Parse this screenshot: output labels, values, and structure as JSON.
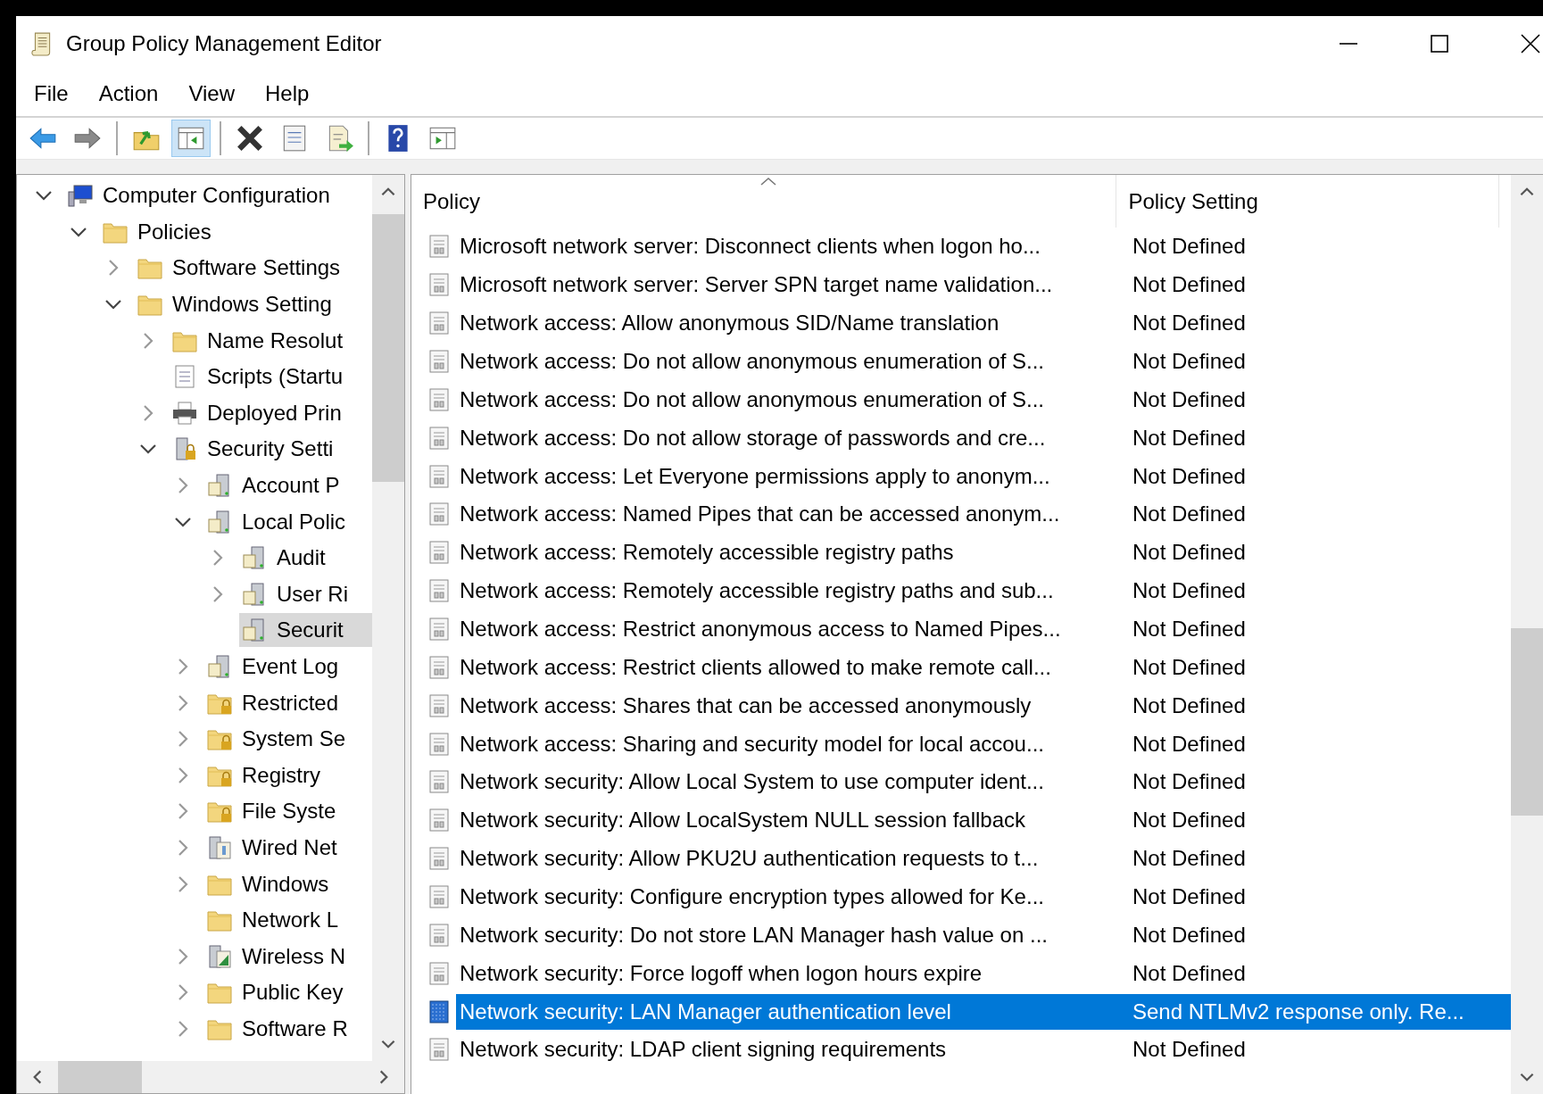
{
  "window": {
    "title": "Group Policy Management Editor"
  },
  "menu": [
    {
      "label": "File"
    },
    {
      "label": "Action"
    },
    {
      "label": "View"
    },
    {
      "label": "Help"
    }
  ],
  "toolbar": [
    {
      "buttons": [
        {
          "kind": "back",
          "pressed": false
        },
        {
          "kind": "forward",
          "pressed": false
        }
      ]
    },
    {
      "buttons": [
        {
          "kind": "up",
          "pressed": false
        },
        {
          "kind": "console-tree",
          "pressed": true
        }
      ]
    },
    {
      "buttons": [
        {
          "kind": "delete",
          "pressed": false
        },
        {
          "kind": "properties",
          "pressed": false
        },
        {
          "kind": "export",
          "pressed": false
        }
      ]
    },
    {
      "buttons": [
        {
          "kind": "help",
          "pressed": false
        },
        {
          "kind": "action-pane",
          "pressed": false
        }
      ]
    }
  ],
  "tree": [
    {
      "label": "Computer Configuration",
      "kind": "computer",
      "has_children": true,
      "expanded": true,
      "selected": false,
      "children": [
        {
          "label": "Policies",
          "kind": "folder",
          "has_children": true,
          "expanded": true,
          "selected": false,
          "children": [
            {
              "label": "Software Settings",
              "kind": "folder",
              "has_children": true,
              "expanded": false,
              "selected": false
            },
            {
              "label": "Windows Setting",
              "kind": "folder",
              "has_children": true,
              "expanded": true,
              "selected": false,
              "children": [
                {
                  "label": "Name Resolut",
                  "kind": "folder",
                  "has_children": true,
                  "expanded": false,
                  "selected": false
                },
                {
                  "label": "Scripts (Startu",
                  "kind": "script",
                  "has_children": false,
                  "selected": false
                },
                {
                  "label": "Deployed Prin",
                  "kind": "printer",
                  "has_children": true,
                  "expanded": false,
                  "selected": false
                },
                {
                  "label": "Security Setti",
                  "kind": "security",
                  "has_children": true,
                  "expanded": true,
                  "selected": false,
                  "children": [
                    {
                      "label": "Account P",
                      "kind": "server",
                      "has_children": true,
                      "expanded": false,
                      "selected": false
                    },
                    {
                      "label": "Local Polic",
                      "kind": "server",
                      "has_children": true,
                      "expanded": true,
                      "selected": false,
                      "children": [
                        {
                          "label": "Audit",
                          "kind": "server",
                          "has_children": true,
                          "expanded": false,
                          "selected": false
                        },
                        {
                          "label": "User Ri",
                          "kind": "server",
                          "has_children": true,
                          "expanded": false,
                          "selected": false
                        },
                        {
                          "label": "Securit",
                          "kind": "server",
                          "has_children": false,
                          "selected": true
                        }
                      ]
                    },
                    {
                      "label": "Event Log",
                      "kind": "server",
                      "has_children": true,
                      "expanded": false,
                      "selected": false
                    },
                    {
                      "label": "Restricted",
                      "kind": "locked-folder",
                      "has_children": true,
                      "expanded": false,
                      "selected": false
                    },
                    {
                      "label": "System Se",
                      "kind": "locked-folder",
                      "has_children": true,
                      "expanded": false,
                      "selected": false
                    },
                    {
                      "label": "Registry",
                      "kind": "locked-folder",
                      "has_children": true,
                      "expanded": false,
                      "selected": false
                    },
                    {
                      "label": "File Syste",
                      "kind": "locked-folder",
                      "has_children": true,
                      "expanded": false,
                      "selected": false
                    },
                    {
                      "label": "Wired Net",
                      "kind": "wired",
                      "has_children": true,
                      "expanded": false,
                      "selected": false
                    },
                    {
                      "label": "Windows",
                      "kind": "folder",
                      "has_children": true,
                      "expanded": false,
                      "selected": false
                    },
                    {
                      "label": "Network L",
                      "kind": "folder",
                      "has_children": false,
                      "selected": false
                    },
                    {
                      "label": "Wireless N",
                      "kind": "wireless",
                      "has_children": true,
                      "expanded": false,
                      "selected": false
                    },
                    {
                      "label": "Public Key",
                      "kind": "folder",
                      "has_children": true,
                      "expanded": false,
                      "selected": false
                    },
                    {
                      "label": "Software R",
                      "kind": "folder",
                      "has_children": true,
                      "expanded": false,
                      "selected": false
                    }
                  ]
                }
              ]
            }
          ]
        }
      ]
    }
  ],
  "columns": [
    {
      "label": "Policy",
      "sorted": true
    },
    {
      "label": "Policy Setting",
      "sorted": false
    }
  ],
  "rows": [
    {
      "policy": "Microsoft network server: Disconnect clients when logon ho...",
      "setting": "Not Defined",
      "selected": false
    },
    {
      "policy": "Microsoft network server: Server SPN target name validation...",
      "setting": "Not Defined",
      "selected": false
    },
    {
      "policy": "Network access: Allow anonymous SID/Name translation",
      "setting": "Not Defined",
      "selected": false
    },
    {
      "policy": "Network access: Do not allow anonymous enumeration of S...",
      "setting": "Not Defined",
      "selected": false
    },
    {
      "policy": "Network access: Do not allow anonymous enumeration of S...",
      "setting": "Not Defined",
      "selected": false
    },
    {
      "policy": "Network access: Do not allow storage of passwords and cre...",
      "setting": "Not Defined",
      "selected": false
    },
    {
      "policy": "Network access: Let Everyone permissions apply to anonym...",
      "setting": "Not Defined",
      "selected": false
    },
    {
      "policy": "Network access: Named Pipes that can be accessed anonym...",
      "setting": "Not Defined",
      "selected": false
    },
    {
      "policy": "Network access: Remotely accessible registry paths",
      "setting": "Not Defined",
      "selected": false
    },
    {
      "policy": "Network access: Remotely accessible registry paths and sub...",
      "setting": "Not Defined",
      "selected": false
    },
    {
      "policy": "Network access: Restrict anonymous access to Named Pipes...",
      "setting": "Not Defined",
      "selected": false
    },
    {
      "policy": "Network access: Restrict clients allowed to make remote call...",
      "setting": "Not Defined",
      "selected": false
    },
    {
      "policy": "Network access: Shares that can be accessed anonymously",
      "setting": "Not Defined",
      "selected": false
    },
    {
      "policy": "Network access: Sharing and security model for local accou...",
      "setting": "Not Defined",
      "selected": false
    },
    {
      "policy": "Network security: Allow Local System to use computer ident...",
      "setting": "Not Defined",
      "selected": false
    },
    {
      "policy": "Network security: Allow LocalSystem NULL session fallback",
      "setting": "Not Defined",
      "selected": false
    },
    {
      "policy": "Network security: Allow PKU2U authentication requests to t...",
      "setting": "Not Defined",
      "selected": false
    },
    {
      "policy": "Network security: Configure encryption types allowed for Ke...",
      "setting": "Not Defined",
      "selected": false
    },
    {
      "policy": "Network security: Do not store LAN Manager hash value on ...",
      "setting": "Not Defined",
      "selected": false
    },
    {
      "policy": "Network security: Force logoff when logon hours expire",
      "setting": "Not Defined",
      "selected": false
    },
    {
      "policy": "Network security: LAN Manager authentication level",
      "setting": "Send NTLMv2 response only. Re...",
      "selected": true
    },
    {
      "policy": "Network security: LDAP client signing requirements",
      "setting": "Not Defined",
      "selected": false
    }
  ]
}
